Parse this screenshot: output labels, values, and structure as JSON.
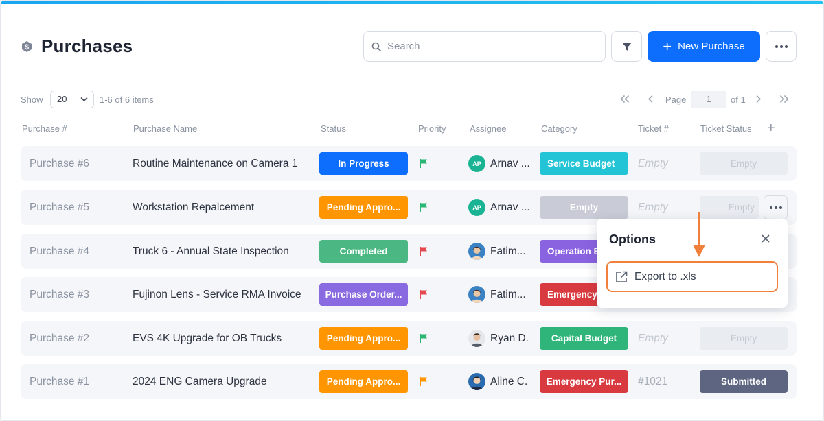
{
  "header": {
    "title": "Purchases",
    "title_icon": "dollar-hexagon-icon",
    "search_placeholder": "Search",
    "new_button_label": "New Purchase",
    "accent_color": "#0d6efd"
  },
  "toolbar": {
    "show_label": "Show",
    "page_size": "20",
    "items_count": "1-6 of 6 items",
    "page_label": "Page",
    "page_value": "1",
    "page_of": "of 1"
  },
  "columns": [
    "Purchase #",
    "Purchase Name",
    "Status",
    "Priority",
    "Assignee",
    "Category",
    "Ticket #",
    "Ticket Status"
  ],
  "rows": [
    {
      "num": "Purchase #6",
      "name": "Routine Maintenance on Camera 1",
      "status": "In Progress",
      "status_color": "#0d6efd",
      "priority_color": "#2bb673",
      "assignee_initials": "AP",
      "assignee_avatar_color": "#1ab394",
      "assignee": "Arnav ...",
      "category": "Service Budget",
      "category_color": "#22c4d6",
      "ticket": "Empty",
      "ticket_status": "Empty"
    },
    {
      "num": "Purchase #5",
      "name": "Workstation Repalcement",
      "status": "Pending Appro...",
      "status_color": "#ff9500",
      "priority_color": "#2bb673",
      "assignee_initials": "AP",
      "assignee_avatar_color": "#1ab394",
      "assignee": "Arnav ...",
      "category": "Empty",
      "category_color": "#c9ccd6",
      "ticket": "Empty",
      "ticket_status": "Empty"
    },
    {
      "num": "Purchase #4",
      "name": "Truck 6 - Annual State Inspection",
      "status": "Completed",
      "status_color": "#4bb782",
      "priority_color": "#e5484d",
      "assignee_initials": "",
      "assignee_avatar_color": "#3b82c4",
      "assignee": "Fatim...",
      "category": "Operation B",
      "category_color": "#8a63e0",
      "ticket": "",
      "ticket_status": ""
    },
    {
      "num": "Purchase #3",
      "name": "Fujinon Lens - Service RMA Invoice",
      "status": "Purchase Order...",
      "status_color": "#8a6ae0",
      "priority_color": "#e5484d",
      "assignee_initials": "",
      "assignee_avatar_color": "#3b82c4",
      "assignee": "Fatim...",
      "category": "Emergency",
      "category_color": "#d93a3f",
      "ticket": "",
      "ticket_status": ""
    },
    {
      "num": "Purchase #2",
      "name": "EVS 4K Upgrade for OB Trucks",
      "status": "Pending Appro...",
      "status_color": "#ff9500",
      "priority_color": "#2bb673",
      "assignee_initials": "",
      "assignee_avatar_color": "#6b7280",
      "assignee": "Ryan D.",
      "category": "Capital Budget",
      "category_color": "#2fb57a",
      "ticket": "Empty",
      "ticket_status": "Empty"
    },
    {
      "num": "Purchase #1",
      "name": "2024 ENG Camera Upgrade",
      "status": "Pending Appro...",
      "status_color": "#ff9500",
      "priority_color": "#ff9500",
      "assignee_initials": "",
      "assignee_avatar_color": "#2b6cb0",
      "assignee": "Aline C.",
      "category": "Emergency Pur...",
      "category_color": "#d93a3f",
      "ticket": "#1021",
      "ticket_status": "Submitted"
    }
  ],
  "popup": {
    "title": "Options",
    "item_label": "Export to .xls",
    "highlight_color": "#f0803c"
  }
}
